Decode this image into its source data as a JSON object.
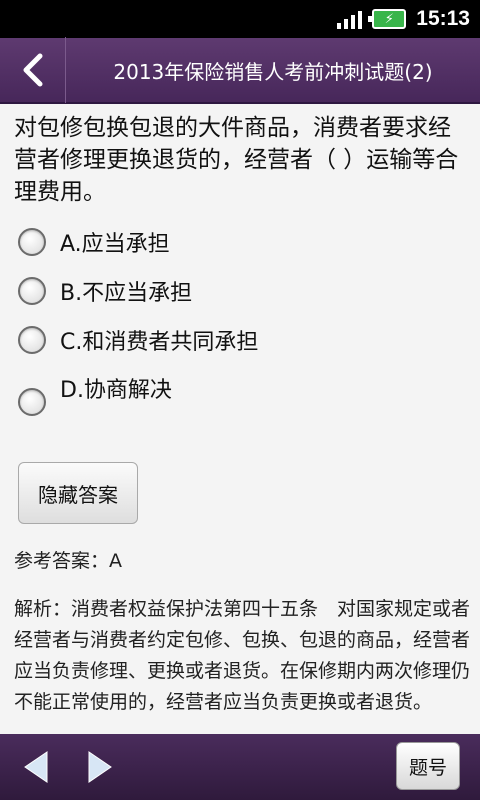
{
  "status_bar": {
    "time": "15:13",
    "battery_icon": "battery-charging-icon",
    "signal_icon": "signal-icon"
  },
  "header": {
    "back_icon": "chevron-left-icon",
    "title": "2013年保险销售人考前冲刺试题(2)"
  },
  "question": {
    "text": "对包修包换包退的大件商品，消费者要求经营者修理更换退货的，经营者（        ）运输等合理费用。",
    "options": [
      {
        "label": "A.应当承担",
        "selected": false
      },
      {
        "label": "B.不应当承担",
        "selected": false
      },
      {
        "label": "C.和消费者共同承担",
        "selected": false
      },
      {
        "label": "D.协商解决",
        "selected": false
      }
    ]
  },
  "hide_answer_label": "隐藏答案",
  "answer_text": "参考答案：A",
  "analysis_text": "解析：消费者权益保护法第四十五条　对国家规定或者经营者与消费者约定包修、包换、包退的商品，经营者应当负责修理、更换或者退货。在保修期内两次修理仍不能正常使用的，经营者应当负责更换或者退货。",
  "bottom_bar": {
    "prev_icon": "arrow-left-icon",
    "next_icon": "arrow-right-icon",
    "question_number_label": "题号"
  },
  "colors": {
    "header_bg": "#4f2f62",
    "page_bg": "#f4f4f4",
    "arrow_fill": "#d7e6f5"
  }
}
